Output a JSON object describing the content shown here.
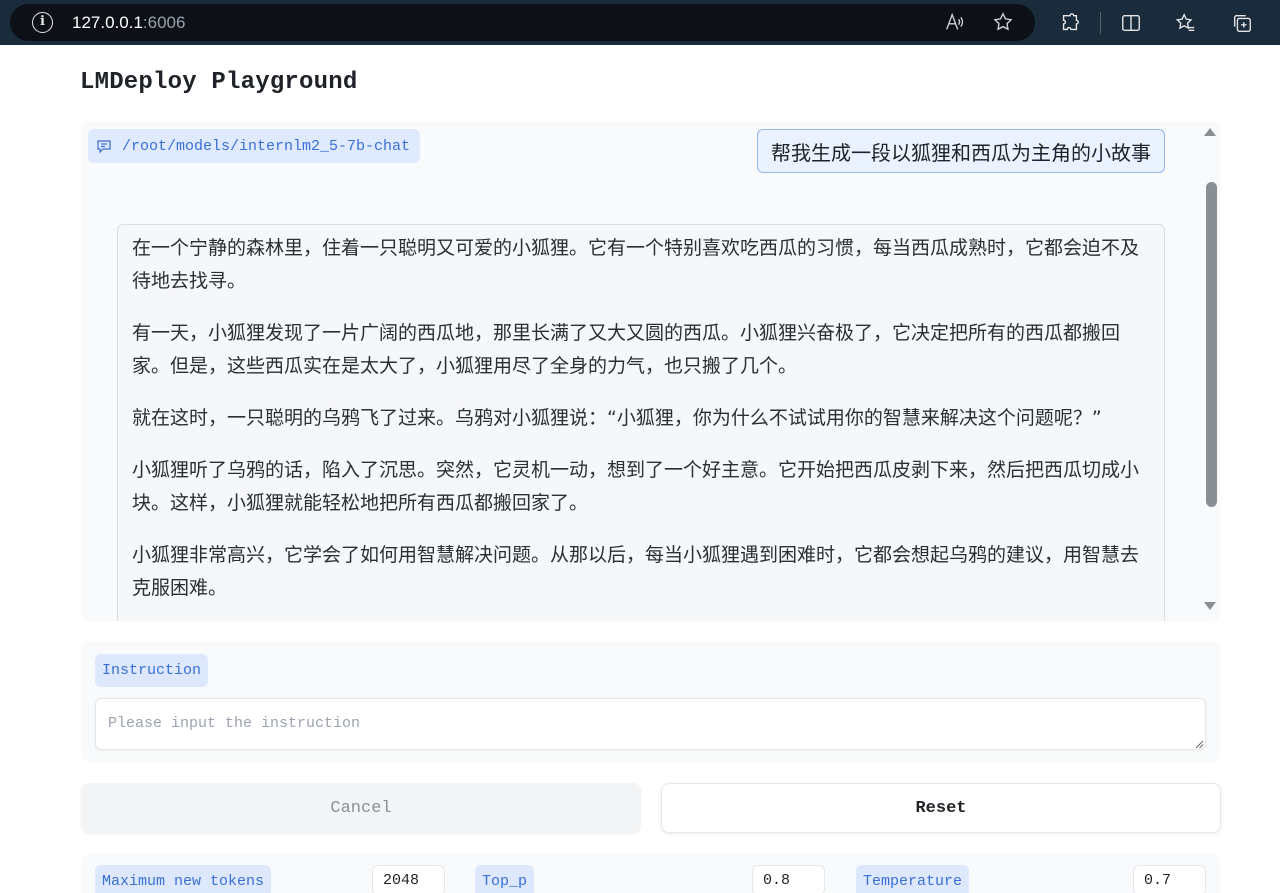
{
  "browser": {
    "url_host": "127.0.0.1",
    "url_port": ":6006",
    "icons": [
      "info-icon",
      "read-aloud-icon",
      "favorite-star-icon",
      "extensions-icon",
      "split-screen-icon",
      "favorites-icon",
      "collections-icon"
    ]
  },
  "app": {
    "title": "LMDeploy Playground"
  },
  "chat": {
    "model_path": "/root/models/internlm2_5-7b-chat",
    "user_message": "帮我生成一段以狐狸和西瓜为主角的小故事",
    "assistant_paragraphs": [
      "在一个宁静的森林里，住着一只聪明又可爱的小狐狸。它有一个特别喜欢吃西瓜的习惯，每当西瓜成熟时，它都会迫不及待地去找寻。",
      "有一天，小狐狸发现了一片广阔的西瓜地，那里长满了又大又圆的西瓜。小狐狸兴奋极了，它决定把所有的西瓜都搬回家。但是，这些西瓜实在是太大了，小狐狸用尽了全身的力气，也只搬了几个。",
      "就在这时，一只聪明的乌鸦飞了过来。乌鸦对小狐狸说：“小狐狸，你为什么不试试用你的智慧来解决这个问题呢？”",
      "小狐狸听了乌鸦的话，陷入了沉思。突然，它灵机一动，想到了一个好主意。它开始把西瓜皮剥下来，然后把西瓜切成小块。这样，小狐狸就能轻松地把所有西瓜都搬回家了。",
      "小狐狸非常高兴，它学会了如何用智慧解决问题。从那以后，每当小狐狸遇到困难时，它都会想起乌鸦的建议，用智慧去克服困难。"
    ]
  },
  "instruction": {
    "label": "Instruction",
    "placeholder": "Please input the instruction",
    "value": ""
  },
  "buttons": {
    "cancel": "Cancel",
    "reset": "Reset"
  },
  "params": {
    "max_tokens_label": "Maximum new tokens",
    "max_tokens_value": "2048",
    "top_p_label": "Top_p",
    "top_p_value": "0.8",
    "temperature_label": "Temperature",
    "temperature_value": "0.7"
  },
  "colors": {
    "accent": "#3a6fd8",
    "chip_bg": "#e0eaff",
    "user_bubble_border": "#92b6ef",
    "chrome_bg": "#1a2b3c"
  }
}
